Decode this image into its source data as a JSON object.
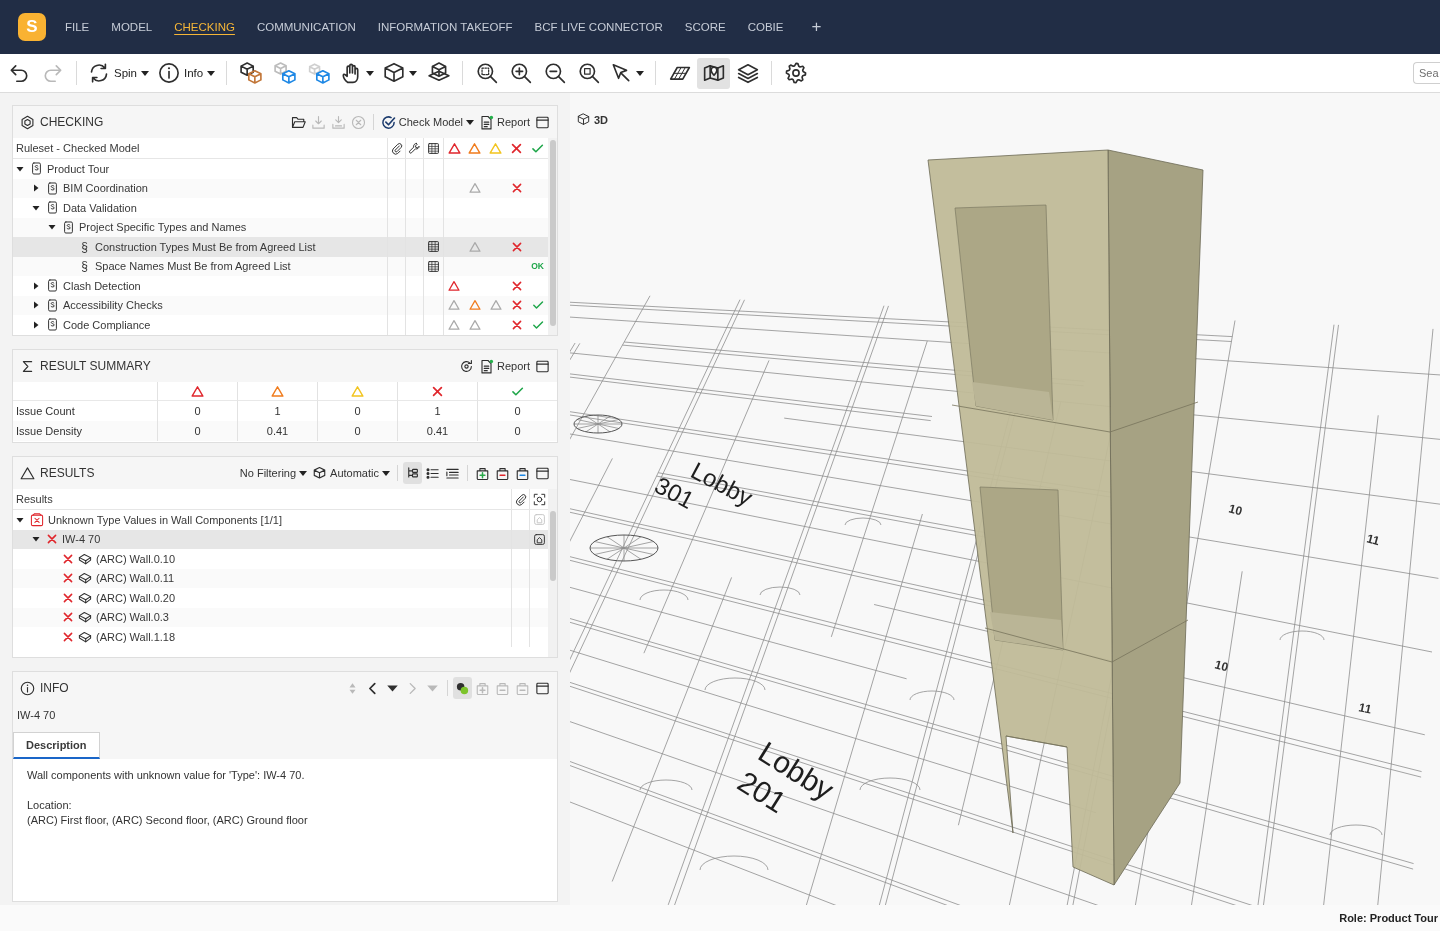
{
  "topbar": {
    "logo": "S",
    "menu": [
      {
        "label": "FILE",
        "selected": false
      },
      {
        "label": "MODEL",
        "selected": false
      },
      {
        "label": "CHECKING",
        "selected": true
      },
      {
        "label": "COMMUNICATION",
        "selected": false
      },
      {
        "label": "INFORMATION TAKEOFF",
        "selected": false
      },
      {
        "label": "BCF LIVE CONNECTOR",
        "selected": false
      },
      {
        "label": "SCORE",
        "selected": false
      },
      {
        "label": "COBIE",
        "selected": false
      }
    ],
    "add_tab": "+"
  },
  "toolbar": {
    "groups": [
      [
        {
          "kind": "undo",
          "on": false,
          "disabled": false
        },
        {
          "kind": "redo",
          "on": false,
          "disabled": true
        }
      ],
      [
        {
          "kind": "spin",
          "label": "Spin",
          "dropdown": true,
          "on": false,
          "disabled": false
        },
        {
          "kind": "info",
          "label": "Info",
          "dropdown": true,
          "on": false,
          "disabled": false
        }
      ],
      [
        {
          "kind": "isolate",
          "on": false,
          "disabled": false
        },
        {
          "kind": "ghost",
          "on": false,
          "disabled": false
        },
        {
          "kind": "show",
          "on": false,
          "disabled": false
        },
        {
          "kind": "effects",
          "dropdown": true,
          "on": false,
          "disabled": false
        },
        {
          "kind": "view",
          "dropdown": true,
          "on": false,
          "disabled": false
        },
        {
          "kind": "section",
          "on": false,
          "disabled": false
        }
      ],
      [
        {
          "kind": "fit",
          "on": false,
          "disabled": false
        },
        {
          "kind": "zoomin",
          "on": false,
          "disabled": false
        },
        {
          "kind": "zoomout",
          "on": false,
          "disabled": false
        },
        {
          "kind": "zoomwindow",
          "on": false,
          "disabled": false
        },
        {
          "kind": "pick",
          "dropdown": true,
          "on": false,
          "disabled": false
        }
      ],
      [
        {
          "kind": "plane",
          "on": false,
          "disabled": false
        },
        {
          "kind": "map",
          "on": true,
          "disabled": false
        },
        {
          "kind": "layers",
          "on": false,
          "disabled": false
        }
      ],
      [
        {
          "kind": "settings",
          "on": false,
          "disabled": false
        }
      ]
    ],
    "search": {
      "placeholder": "Sea"
    }
  },
  "checking": {
    "title": "CHECKING",
    "actions": [
      [
        {
          "kind": "open",
          "disabled": false
        },
        {
          "kind": "import",
          "disabled": true
        },
        {
          "kind": "export",
          "disabled": true
        },
        {
          "kind": "cancel",
          "disabled": true
        }
      ],
      [
        {
          "kind": "check",
          "label": "Check Model",
          "dropdown": true,
          "disabled": false
        },
        {
          "kind": "report",
          "label": "Report",
          "disabled": false
        },
        {
          "kind": "maximize",
          "disabled": false
        }
      ]
    ],
    "tree": {
      "heading": "Ruleset - Checked Model",
      "rows": [
        {
          "kind": "ruleset",
          "label": "Product Tour",
          "expanded": true,
          "selected": false,
          "children": [
            {
              "kind": "ruleset",
              "label": "BIM Coordination",
              "expanded": false,
              "selected": false,
              "marks": {
                "major": {
                  "muted": true
                },
                "failed": {
                  "muted": false
                }
              }
            },
            {
              "kind": "ruleset",
              "label": "Data Validation",
              "expanded": true,
              "selected": false,
              "children": [
                {
                  "kind": "ruleset",
                  "label": "Project Specific Types and Names",
                  "expanded": true,
                  "selected": false,
                  "children": [
                    {
                      "kind": "rule",
                      "symbol": "§",
                      "label": "Construction Types Must Be from Agreed List",
                      "selected": true,
                      "table": true,
                      "marks": {
                        "major": {
                          "muted": true
                        },
                        "failed": {
                          "muted": false
                        }
                      }
                    },
                    {
                      "kind": "rule",
                      "symbol": "§",
                      "label": "Space Names Must Be from Agreed List",
                      "selected": false,
                      "table": true,
                      "passed_text": "OK"
                    }
                  ]
                }
              ]
            },
            {
              "kind": "ruleset",
              "label": "Clash Detection",
              "expanded": false,
              "selected": false,
              "marks": {
                "critical": {
                  "muted": false
                },
                "failed": {
                  "muted": false
                }
              }
            },
            {
              "kind": "ruleset",
              "label": "Accessibility Checks",
              "expanded": false,
              "selected": false,
              "marks": {
                "critical": {
                  "muted": true
                },
                "major": {
                  "muted": false
                },
                "minor": {
                  "muted": true
                },
                "failed": {
                  "muted": false
                },
                "passed": {
                  "muted": false
                }
              }
            },
            {
              "kind": "ruleset",
              "label": "Code Compliance",
              "expanded": false,
              "selected": false,
              "marks": {
                "critical": {
                  "muted": true
                },
                "major": {
                  "muted": true
                },
                "failed": {
                  "muted": false
                },
                "passed": {
                  "muted": false
                }
              }
            }
          ]
        }
      ]
    }
  },
  "result_summary": {
    "title": "RESULT SUMMARY",
    "actions": [
      [
        {
          "kind": "refresh",
          "disabled": false
        },
        {
          "kind": "report",
          "label": "Report",
          "disabled": false
        },
        {
          "kind": "maximize",
          "disabled": false
        }
      ]
    ],
    "rows": [
      {
        "label": "Issue Count",
        "values": [
          "0",
          "1",
          "0",
          "1",
          "0"
        ]
      },
      {
        "label": "Issue Density",
        "values": [
          "0",
          "0.41",
          "0",
          "0.41",
          "0"
        ]
      }
    ]
  },
  "results": {
    "title": "RESULTS",
    "actions": [
      [
        {
          "kind": "filter",
          "label": "No Filtering",
          "dropdown": true,
          "disabled": false
        },
        {
          "kind": "mode",
          "label": "Automatic",
          "dropdown": true,
          "disabled": false
        }
      ],
      [
        {
          "kind": "tree",
          "selected": true,
          "disabled": false
        },
        {
          "kind": "list",
          "selected": false,
          "disabled": false
        },
        {
          "kind": "grouped",
          "selected": false,
          "disabled": false
        }
      ],
      [
        {
          "kind": "add",
          "disabled": false
        },
        {
          "kind": "remove",
          "disabled": false
        },
        {
          "kind": "edit",
          "disabled": false
        },
        {
          "kind": "maximize",
          "disabled": false
        }
      ]
    ],
    "heading": "Results",
    "rows": [
      {
        "kind": "issue",
        "label": "Unknown Type Values in Wall Components [1/1]",
        "expanded": true,
        "selected": false,
        "viewpoint": {
          "muted": true
        },
        "children": [
          {
            "kind": "group",
            "label": "IW-4 70",
            "expanded": true,
            "selected": true,
            "viewpoint": {
              "muted": false
            },
            "children": [
              {
                "kind": "component",
                "label": "(ARC) Wall.0.10",
                "selected": false
              },
              {
                "kind": "component",
                "label": "(ARC) Wall.0.11",
                "selected": false
              },
              {
                "kind": "component",
                "label": "(ARC) Wall.0.20",
                "selected": false
              },
              {
                "kind": "component",
                "label": "(ARC) Wall.0.3",
                "selected": false
              },
              {
                "kind": "component",
                "label": "(ARC) Wall.1.18",
                "selected": false
              }
            ]
          }
        ]
      }
    ]
  },
  "info": {
    "title": "INFO",
    "actions": [
      [
        {
          "kind": "sort",
          "on": false,
          "disabled": true
        },
        {
          "kind": "prev",
          "on": false,
          "disabled": false
        },
        {
          "kind": "prevmenu",
          "on": false,
          "disabled": false
        },
        {
          "kind": "next",
          "on": false,
          "disabled": true
        },
        {
          "kind": "nextmenu",
          "on": false,
          "disabled": true
        }
      ],
      [
        {
          "kind": "sync",
          "on": true,
          "disabled": false
        },
        {
          "kind": "add",
          "on": false,
          "disabled": true
        },
        {
          "kind": "remove",
          "on": false,
          "disabled": true
        },
        {
          "kind": "edit",
          "on": false,
          "disabled": true
        },
        {
          "kind": "maximize",
          "on": false,
          "disabled": false
        }
      ]
    ],
    "subject": "IW-4 70",
    "tabs": [
      {
        "label": "Description",
        "selected": true
      }
    ],
    "description": "Wall components with unknown value for 'Type': IW-4 70.",
    "location_label": "Location:",
    "location": "(ARC) First floor, (ARC) Second floor, (ARC) Ground floor"
  },
  "viewport": {
    "label": "3D",
    "room_labels": [
      {
        "name": "Lobby",
        "number": "301"
      },
      {
        "name": "Lobby",
        "number": "201"
      }
    ],
    "grid_labels": [
      "10",
      "11",
      "10",
      "11"
    ]
  },
  "status_bar": {
    "role": "Role: Product Tour"
  }
}
